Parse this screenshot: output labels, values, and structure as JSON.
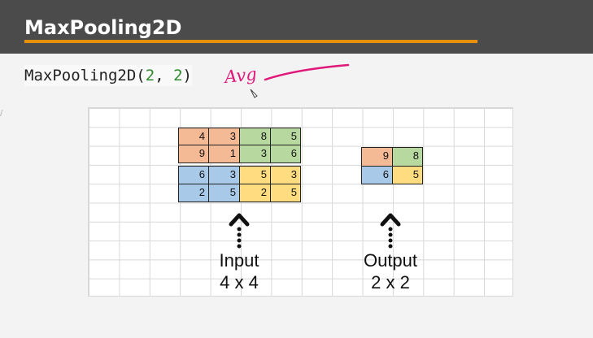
{
  "header": {
    "title": "MaxPooling2D"
  },
  "code": {
    "name": "MaxPooling2D(",
    "arg1": "2",
    "sep": ", ",
    "arg2": "2",
    "close": ")"
  },
  "annotation": {
    "text": "Avg",
    "color": "#e0187a"
  },
  "input_matrix": {
    "rows": [
      [
        "4",
        "3",
        "8",
        "5"
      ],
      [
        "9",
        "1",
        "3",
        "6"
      ],
      [
        "6",
        "3",
        "5",
        "3"
      ],
      [
        "2",
        "5",
        "2",
        "5"
      ]
    ],
    "quadrant_colors": {
      "top_left": "#f4b995",
      "top_right": "#b7d9a0",
      "bottom_left": "#a9c9e8",
      "bottom_right": "#ffdc80"
    },
    "label": "Input",
    "size": "4 x 4"
  },
  "output_matrix": {
    "rows": [
      [
        "9",
        "8"
      ],
      [
        "6",
        "5"
      ]
    ],
    "label": "Output",
    "size": "2 x 2"
  },
  "colors": {
    "header_bg": "#4b4b4b",
    "header_underline": "#e8900e",
    "slide_bg": "#f3f3f3"
  }
}
